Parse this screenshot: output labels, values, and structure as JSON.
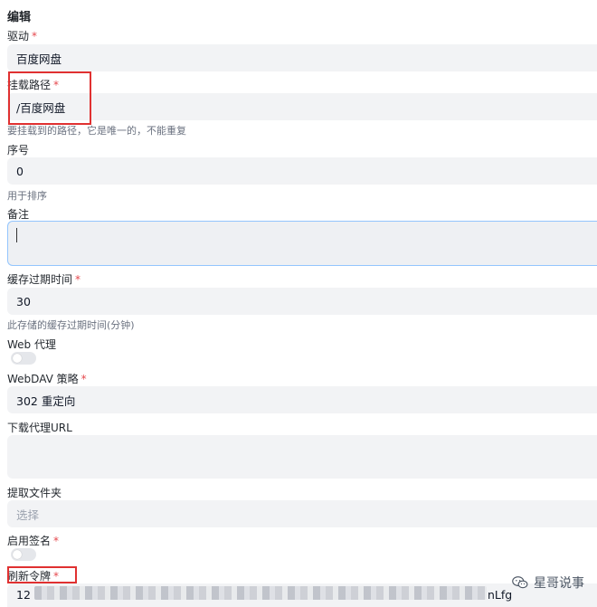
{
  "page": {
    "title": "编辑"
  },
  "fields": {
    "driver": {
      "label": "驱动",
      "required": true,
      "value": "百度网盘"
    },
    "mount_path": {
      "label": "挂载路径",
      "required": true,
      "value": "/百度网盘",
      "help": "要挂载到的路径，它是唯一的，不能重复"
    },
    "order": {
      "label": "序号",
      "value": "0",
      "help": "用于排序"
    },
    "remark": {
      "label": "备注",
      "value": ""
    },
    "cache_expiration": {
      "label": "缓存过期时间",
      "required": true,
      "value": "30",
      "help": "此存储的缓存过期时间(分钟)"
    },
    "web_proxy": {
      "label": "Web 代理",
      "enabled": false
    },
    "webdav_policy": {
      "label": "WebDAV 策略",
      "required": true,
      "value": "302 重定向"
    },
    "download_proxy_url": {
      "label": "下载代理URL",
      "value": ""
    },
    "extract_folder": {
      "label": "提取文件夹",
      "placeholder": "选择"
    },
    "enable_sign": {
      "label": "启用签名",
      "required": true,
      "enabled": false
    },
    "refresh_token": {
      "label": "刷新令牌",
      "required": true,
      "value_prefix": "12",
      "value_suffix": "nLfg"
    }
  },
  "required_mark": "*",
  "watermark": {
    "text": "星哥说事",
    "icon": "wechat-icon"
  },
  "colors": {
    "required": "#e5484d",
    "highlight_box": "#e03131",
    "focus_border": "#93c5fd"
  }
}
